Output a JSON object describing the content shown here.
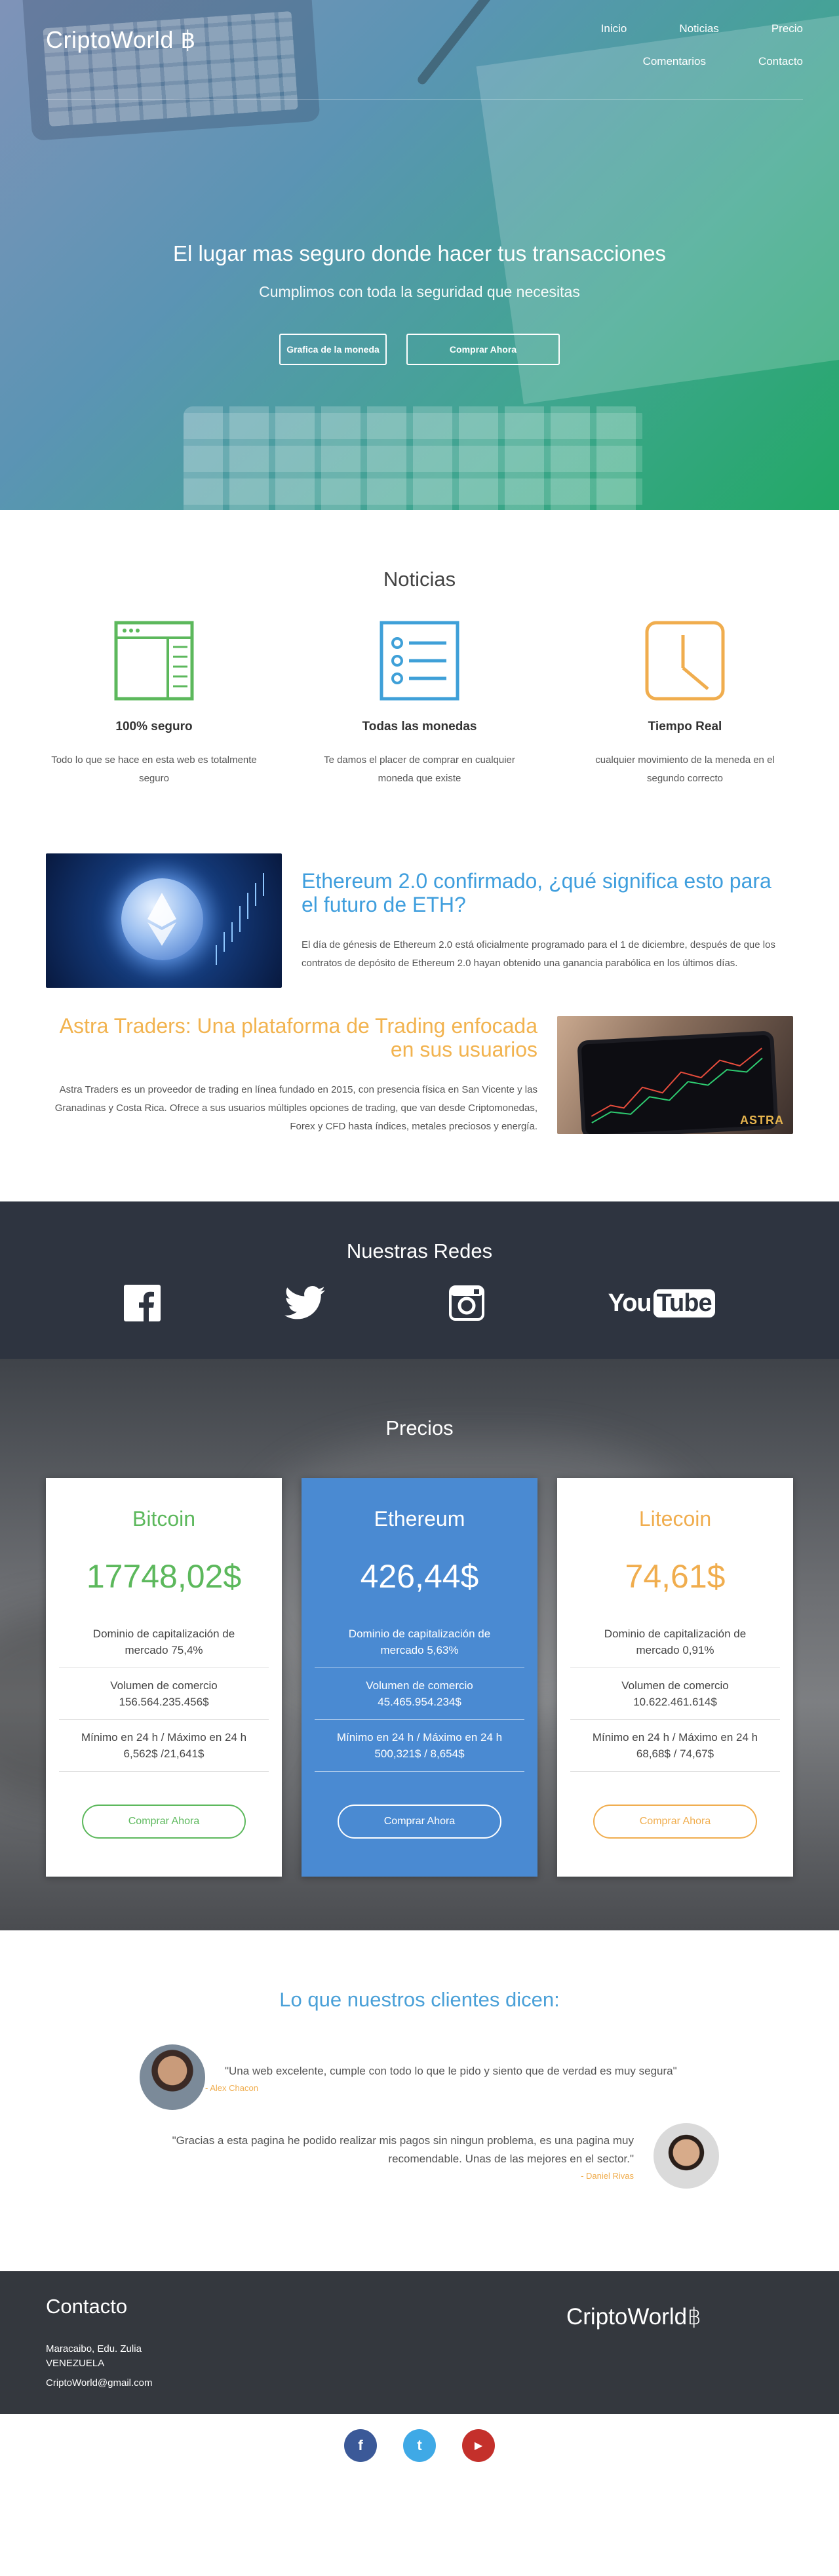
{
  "header": {
    "brand": "CriptoWorld ฿",
    "nav": [
      "Inicio",
      "Noticias",
      "Precio",
      "Comentarios",
      "Contacto"
    ]
  },
  "hero": {
    "title": "El lugar mas seguro donde hacer tus transacciones",
    "subtitle": "Cumplimos con toda la seguridad que necesitas",
    "btn_chart": "Grafica de la moneda",
    "btn_buy": "Comprar Ahora"
  },
  "news": {
    "title": "Noticias",
    "features": [
      {
        "icon": "browser-window-icon",
        "title": "100% seguro",
        "text": "Todo lo que se hace en esta web es totalmente seguro",
        "color": "#5cb85c"
      },
      {
        "icon": "list-icon",
        "title": "Todas las monedas",
        "text": "Te damos el placer de comprar en cualquier moneda que existe",
        "color": "#3fa0d8"
      },
      {
        "icon": "clock-icon",
        "title": "Tiempo Real",
        "text": "cualquier movimiento de la meneda en el segundo correcto",
        "color": "#f0ad4e"
      }
    ],
    "articles": [
      {
        "title": "Ethereum 2.0 confirmado, ¿qué significa esto para el futuro de ETH?",
        "text": "El día de génesis de Ethereum 2.0 está oficialmente programado para el 1 de diciembre, después de que los contratos de depósito de Ethereum 2.0 hayan obtenido una ganancia parabólica en los últimos días."
      },
      {
        "title": "Astra Traders: Una plataforma de Trading enfocada en sus usuarios",
        "text": "Astra Traders es un proveedor de trading en línea fundado en 2015, con presencia física en San Vicente y las Granadinas y Costa Rica. Ofrece a sus usuarios múltiples opciones de trading, que van desde Criptomonedas, Forex y CFD hasta índices, metales preciosos y energía.",
        "image_text": "ASTRA"
      }
    ]
  },
  "redes": {
    "title": "Nuestras Redes",
    "items": [
      "facebook-icon",
      "twitter-icon",
      "instagram-icon",
      "youtube-icon"
    ],
    "youtube_you": "You",
    "youtube_tube": "Tube"
  },
  "precios": {
    "title": "Precios",
    "cards": [
      {
        "name": "Bitcoin",
        "price": "17748,02$",
        "dominance": "Dominio de capitalización de mercado 75,4%",
        "volume_label": "Volumen de comercio",
        "volume": "156.564.235.456$",
        "range_label": "Mínimo en 24 h / Máximo en 24 h",
        "range": "6,562$ /21,641$",
        "button": "Comprar Ahora",
        "color": "#5cb85c"
      },
      {
        "name": "Ethereum",
        "price": "426,44$",
        "dominance": "Dominio de capitalización de mercado 5,63%",
        "volume_label": "Volumen de comercio",
        "volume": "45.465.954.234$",
        "range_label": "Mínimo en 24 h / Máximo en 24 h",
        "range": "500,321$ / 8,654$",
        "button": "Comprar Ahora",
        "color": "#4a8ad2"
      },
      {
        "name": "Litecoin",
        "price": "74,61$",
        "dominance": "Dominio de capitalización de mercado 0,91%",
        "volume_label": "Volumen de comercio",
        "volume": "10.622.461.614$",
        "range_label": "Mínimo en 24 h / Máximo en 24 h",
        "range": "68,68$ / 74,67$",
        "button": "Comprar Ahora",
        "color": "#f0ad4e"
      }
    ]
  },
  "testimonios": {
    "title": "Lo que nuestros clientes dicen:",
    "items": [
      {
        "quote": "\"Una web excelente, cumple con todo lo que le pido y siento que de verdad es muy segura\"",
        "author": "- Alex Chacon"
      },
      {
        "quote": "\"Gracias a esta pagina he podido realizar mis pagos sin ningun problema, es una pagina muy recomendable. Unas de las mejores en el sector.\"",
        "author": "- Daniel Rivas"
      }
    ]
  },
  "contacto": {
    "title": "Contacto",
    "address_line1": "Maracaibo, Edu. Zulia",
    "address_line2": "VENEZUELA",
    "email": "CriptoWorld@gmail.com",
    "brand": "CriptoWorld฿"
  },
  "footer": {
    "items": [
      "facebook-icon",
      "twitter-icon",
      "youtube-icon"
    ],
    "fb_glyph": "f",
    "tw_glyph": "t",
    "yt_glyph": "▶"
  }
}
